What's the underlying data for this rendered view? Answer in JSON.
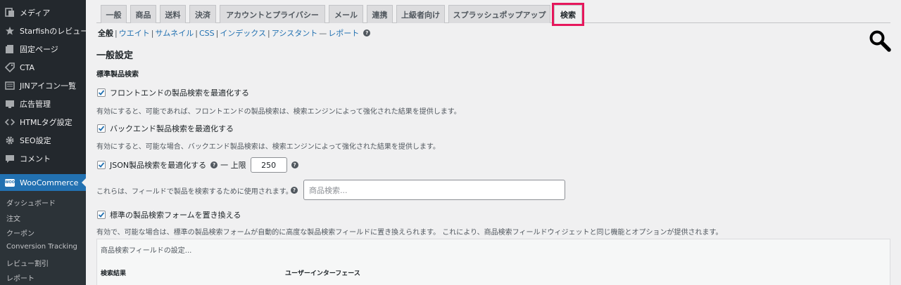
{
  "sidebar": {
    "items": [
      {
        "label": "メディア",
        "icon": "media-icon"
      },
      {
        "label": "Starfishのレビュー",
        "icon": "star-icon"
      },
      {
        "label": "固定ページ",
        "icon": "page-icon"
      },
      {
        "label": "CTA",
        "icon": "tag-icon"
      },
      {
        "label": "JINアイコン一覧",
        "icon": "list-icon"
      },
      {
        "label": "広告管理",
        "icon": "ad-icon"
      },
      {
        "label": "HTMLタグ設定",
        "icon": "code-icon"
      },
      {
        "label": "SEO設定",
        "icon": "gear-icon"
      },
      {
        "label": "コメント",
        "icon": "comment-icon"
      }
    ],
    "active": {
      "label": "WooCommerce",
      "badge": "WOO"
    },
    "submenu": [
      "ダッシュボード",
      "注文",
      "クーポン",
      "Conversion Tracking",
      "レビュー割引",
      "レポート"
    ]
  },
  "tabs": [
    "一般",
    "商品",
    "送料",
    "決済",
    "アカウントとプライバシー",
    "メール",
    "連携",
    "上級者向け",
    "スプラッシュポップアップ",
    "検索"
  ],
  "active_tab": "検索",
  "sublinks": {
    "current": "全般",
    "links": [
      "ウエイト",
      "サムネイル",
      "CSS",
      "インデックス",
      "アシスタント",
      "レポート"
    ],
    "sep_dash": "—",
    "help": "?"
  },
  "section_title": "一般設定",
  "subsection_title": "標準製品検索",
  "options": {
    "frontend": {
      "label": "フロントエンドの製品検索を最適化する",
      "checked": true,
      "desc": "有効にすると、可能であれば、フロントエンドの製品検索は、検索エンジンによって強化された結果を提供します。"
    },
    "backend": {
      "label": "バックエンド製品検索を最適化する",
      "checked": true,
      "desc": "有効にすると、可能な場合、バックエンド製品検索は、検索エンジンによって強化された結果を提供します。"
    },
    "json": {
      "label": "JSON製品検索を最適化する",
      "checked": true,
      "limit_label": "一 上限",
      "limit_value": "250",
      "desc": "これらは、フィールドで製品を検索するために使用されます。",
      "search_placeholder": "商品検索..."
    },
    "replace": {
      "label": "標準の製品検索フォームを置き換える",
      "checked": true,
      "desc": "有効で、可能な場合は、標準の製品検索フォームが自動的に高度な製品検索フィールドに置き換えられます。 これにより、商品検索フィールドウィジェットと同じ機能とオプションが提供されます。"
    }
  },
  "panel": {
    "title": "商品検索フィールドの設定...",
    "col1": "検索結果",
    "col2": "ユーザーインターフェース"
  },
  "colors": {
    "sidebar_bg": "#23282d",
    "accent": "#2271b1",
    "highlight": "#e6175c"
  }
}
